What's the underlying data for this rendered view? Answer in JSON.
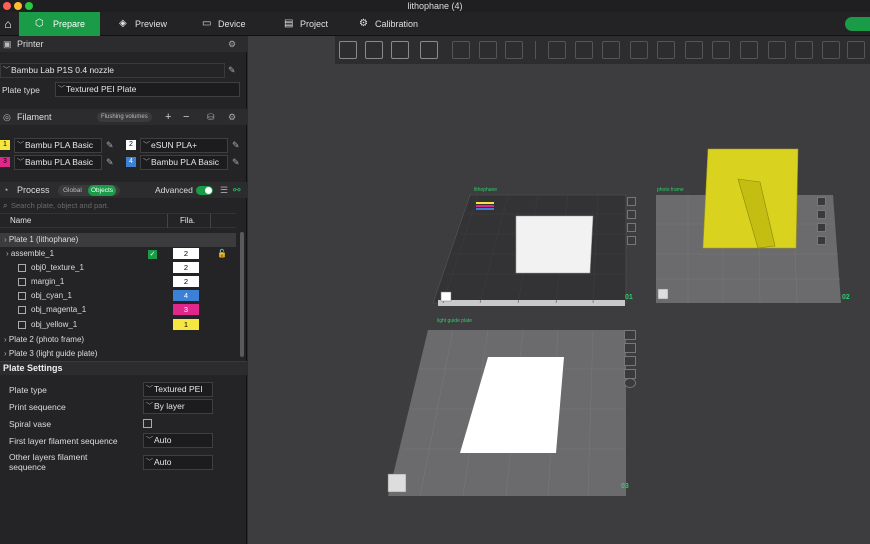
{
  "window": {
    "title": "lithophane (4)"
  },
  "tabs": [
    {
      "label": "Prepare",
      "icon": "cube-icon"
    },
    {
      "label": "Preview",
      "icon": "layers-icon"
    },
    {
      "label": "Device",
      "icon": "monitor-icon"
    },
    {
      "label": "Project",
      "icon": "document-icon"
    },
    {
      "label": "Calibration",
      "icon": "calibration-icon"
    }
  ],
  "printer": {
    "section_label": "Printer",
    "model": "Bambu Lab P1S 0.4 nozzle",
    "plate_type_label": "Plate type",
    "plate_type": "Textured PEI Plate"
  },
  "filament": {
    "section_label": "Filament",
    "flushing_label": "Flushing volumes",
    "slots": [
      {
        "num": "1",
        "name": "Bambu PLA Basic",
        "color": "#f5e642"
      },
      {
        "num": "2",
        "name": "eSUN PLA+",
        "color": "#ffffff"
      },
      {
        "num": "3",
        "name": "Bambu PLA Basic",
        "color": "#e0288c"
      },
      {
        "num": "4",
        "name": "Bambu PLA Basic",
        "color": "#3b82d6"
      }
    ]
  },
  "process": {
    "section_label": "Process",
    "toggle_global": "Global",
    "toggle_objects": "Objects",
    "advanced_label": "Advanced",
    "search_placeholder": "Search plate, object and part.",
    "col_name": "Name",
    "col_fila": "Fila."
  },
  "tree": {
    "plate1": "Plate 1 (lithophane)",
    "assemble": "assemble_1",
    "assemble_fil": "2",
    "parts": [
      {
        "name": "obj0_texture_1",
        "fil": "2",
        "color": "#ffffff"
      },
      {
        "name": "margin_1",
        "fil": "2",
        "color": "#ffffff"
      },
      {
        "name": "obj_cyan_1",
        "fil": "4",
        "color": "#3b82d6"
      },
      {
        "name": "obj_magenta_1",
        "fil": "3",
        "color": "#e0288c"
      },
      {
        "name": "obj_yellow_1",
        "fil": "1",
        "color": "#f5e642"
      }
    ],
    "plate2": "Plate 2 (photo frame)",
    "plate3": "Plate 3 (light guide plate)"
  },
  "plate_settings": {
    "title": "Plate Settings",
    "plate_type_label": "Plate type",
    "plate_type_value": "Textured PEI ...",
    "print_sequence_label": "Print sequence",
    "print_sequence_value": "By layer",
    "spiral_vase_label": "Spiral vase",
    "first_layer_label": "First layer filament sequence",
    "first_layer_value": "Auto",
    "other_layers_label": "Other layers filament sequence",
    "other_layers_value": "Auto"
  },
  "viewport": {
    "plate1_name": "lithophane",
    "plate2_name": "photo frame",
    "plate3_name": "light guide plate",
    "plate1_num": "01",
    "plate2_num": "02",
    "plate3_num": "03",
    "accent": "#1a9b48"
  }
}
